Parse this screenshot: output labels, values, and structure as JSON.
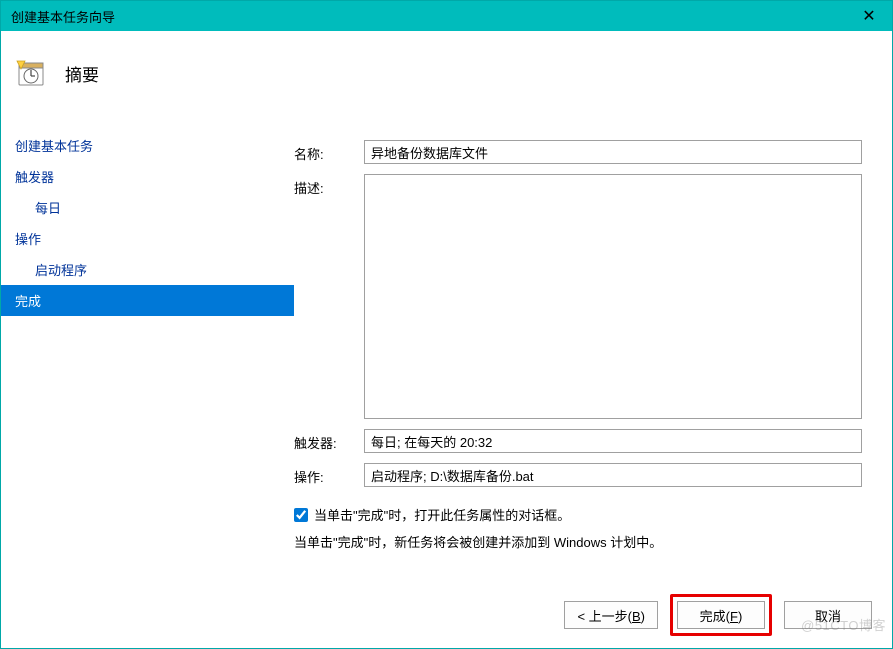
{
  "window": {
    "title": "创建基本任务向导",
    "close_glyph": "✕"
  },
  "header": {
    "title": "摘要"
  },
  "sidebar": {
    "items": [
      {
        "label": "创建基本任务",
        "sub": false,
        "selected": false
      },
      {
        "label": "触发器",
        "sub": false,
        "selected": false
      },
      {
        "label": "每日",
        "sub": true,
        "selected": false
      },
      {
        "label": "操作",
        "sub": false,
        "selected": false
      },
      {
        "label": "启动程序",
        "sub": true,
        "selected": false
      },
      {
        "label": "完成",
        "sub": false,
        "selected": true
      }
    ]
  },
  "form": {
    "name_label": "名称:",
    "name_value": "异地备份数据库文件",
    "desc_label": "描述:",
    "desc_value": "",
    "trigger_label": "触发器:",
    "trigger_value": "每日; 在每天的 20:32",
    "action_label": "操作:",
    "action_value": "启动程序; D:\\数据库备份.bat",
    "checkbox_label": "当单击\"完成\"时，打开此任务属性的对话框。",
    "info_text": "当单击\"完成\"时，新任务将会被创建并添加到 Windows 计划中。"
  },
  "buttons": {
    "back_prefix": "<  上一步(",
    "back_key": "B",
    "back_suffix": ")",
    "finish_prefix": "完成(",
    "finish_key": "F",
    "finish_suffix": ")",
    "cancel": "取消"
  },
  "watermark": "@51CTO博客"
}
